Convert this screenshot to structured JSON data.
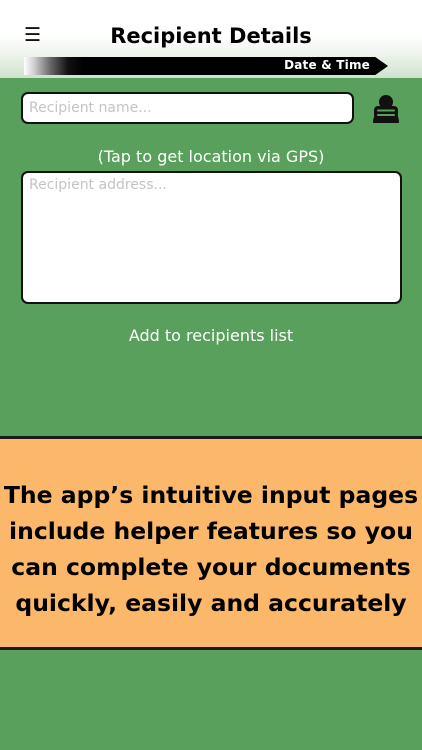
{
  "header": {
    "title": "Recipient Details",
    "menu_icon": "menu-icon",
    "breadcrumb_next": "Date & Time"
  },
  "form": {
    "name_placeholder": "Recipient name...",
    "contacts_icon": "contacts-icon",
    "gps_link": "(Tap to get location via GPS)",
    "address_placeholder": "Recipient address...",
    "add_link": "Add to recipients list"
  },
  "banner": {
    "lines": [
      "The app’s intuitive input pages",
      "include helper features so you",
      "can complete your documents",
      "quickly, easily and accurately"
    ]
  },
  "colors": {
    "background": "#58a05b",
    "banner": "#fbb76a"
  }
}
